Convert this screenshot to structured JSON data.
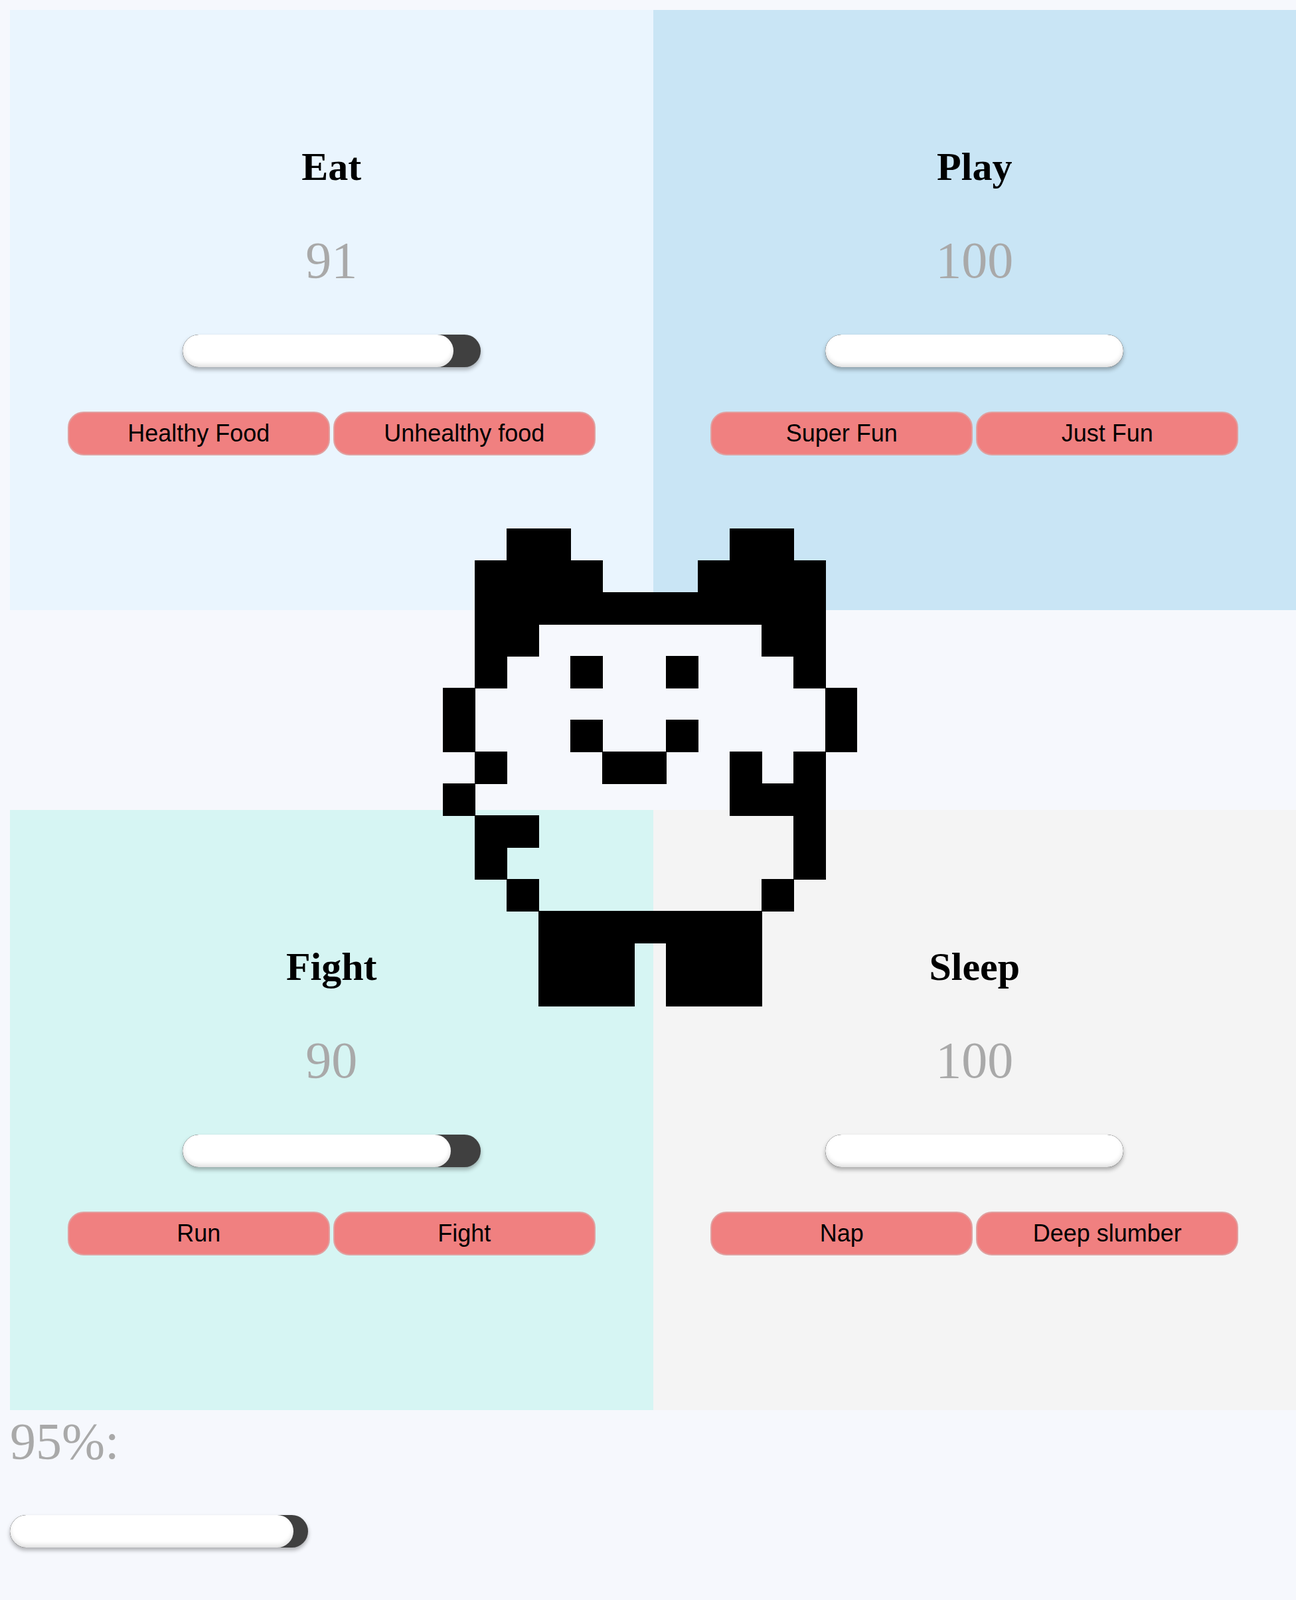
{
  "panels": [
    {
      "title": "Eat",
      "value": "91",
      "level": 0.91,
      "buttons": [
        "Healthy Food",
        "Unhealthy food"
      ]
    },
    {
      "title": "Play",
      "value": "100",
      "level": 1.0,
      "buttons": [
        "Super Fun",
        "Just Fun"
      ]
    },
    {
      "title": "Fight",
      "value": "90",
      "level": 0.9,
      "buttons": [
        "Run",
        "Fight"
      ]
    },
    {
      "title": "Sleep",
      "value": "100",
      "level": 1.0,
      "buttons": [
        "Nap",
        "Deep slumber"
      ]
    }
  ],
  "overall": {
    "reading": "95%:",
    "level": 0.95
  }
}
